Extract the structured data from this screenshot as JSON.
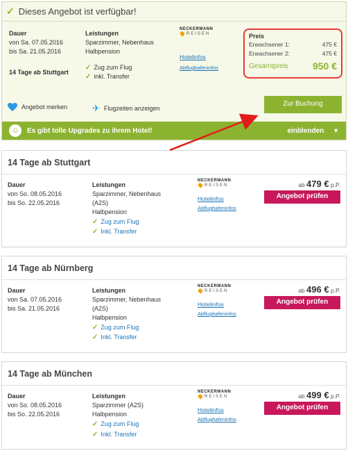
{
  "top": {
    "title": "Dieses Angebot ist verfügbar!",
    "dauer_label": "Dauer",
    "von": "von Sa. 07.05.2016",
    "bis": "bis Sa. 21.05.2016",
    "trip": "14 Tage ab Stuttgart",
    "leistungen_label": "Leistungen",
    "room": "Sparzimmer, Nebenhaus",
    "board": "Halbpension",
    "features": [
      "Zug zum Flug",
      "inkl. Transfer"
    ],
    "logo_line1": "NECKERMANN",
    "logo_line2": "REISEN",
    "hotelinfos": "Hotelinfos",
    "abflug": "Abflughafeninfos",
    "preis_label": "Preis",
    "prices": [
      {
        "label": "Erwachsener 1:",
        "value": "475 €"
      },
      {
        "label": "Erwachsener 2:",
        "value": "475 €"
      }
    ],
    "total_label": "Gesamtpreis",
    "total_value": "950 €",
    "merken": "Angebot merken",
    "flugzeiten": "Flugzeiten anzeigen",
    "buchung": "Zur Buchung",
    "upgrade_text": "Es gibt tolle Upgrades zu ihrem Hotel!",
    "einblenden": "einblenden"
  },
  "offers": [
    {
      "title": "14 Tage ab Stuttgart",
      "dauer_label": "Dauer",
      "von": "von So. 08.05.2016",
      "bis": "bis So. 22.05.2016",
      "leistungen_label": "Leistungen",
      "room_lines": [
        "Sparzimmer, Nebenhaus",
        "(A2S)"
      ],
      "board": "Halbpension",
      "features": [
        "Zug zum Flug",
        "Inkl. Transfer"
      ],
      "ab": "ab",
      "price": "479 €",
      "pp": "p.P.",
      "button": "Angebot prüfen"
    },
    {
      "title": "14 Tage ab Nürnberg",
      "dauer_label": "Dauer",
      "von": "von Sa. 07.05.2016",
      "bis": "bis Sa. 21.05.2016",
      "leistungen_label": "Leistungen",
      "room_lines": [
        "Sparzimmer, Nebenhaus",
        "(A2S)"
      ],
      "board": "Halbpension",
      "features": [
        "Zug zum Flug",
        "Inkl. Transfer"
      ],
      "ab": "ab",
      "price": "496 €",
      "pp": "p.P.",
      "button": "Angebot prüfen"
    },
    {
      "title": "14 Tage ab München",
      "dauer_label": "Dauer",
      "von": "von So. 08.05.2016",
      "bis": "bis So. 22.05.2016",
      "leistungen_label": "Leistungen",
      "room_lines": [
        "Sparzimmer (A2S)"
      ],
      "board": "Halbpension",
      "features": [
        "Zug zum Flug",
        "Inkl. Transfer"
      ],
      "ab": "ab",
      "price": "499 €",
      "pp": "p.P.",
      "button": "Angebot prüfen"
    }
  ],
  "colors": {
    "accent_green": "#8cb330",
    "cta_pink": "#c8185b",
    "highlight_red": "#e53935",
    "link_blue": "#1a73b8"
  }
}
